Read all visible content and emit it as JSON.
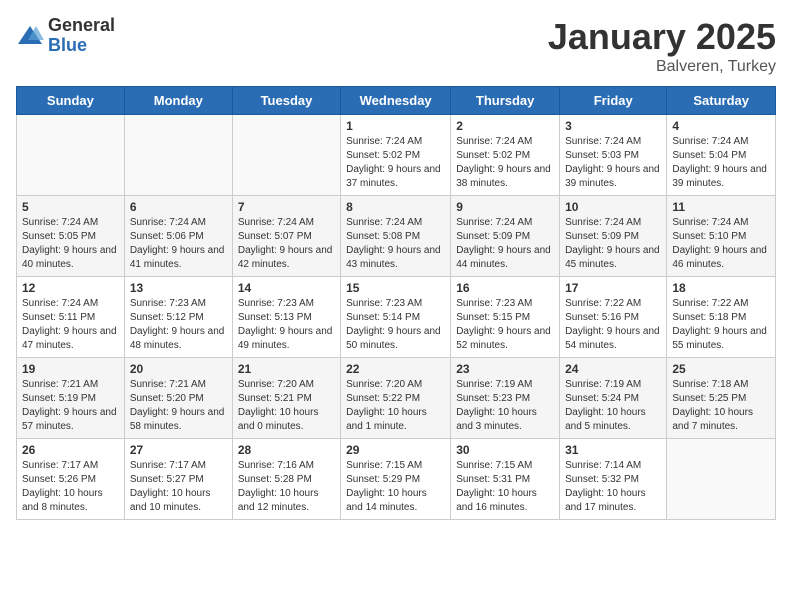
{
  "logo": {
    "general": "General",
    "blue": "Blue"
  },
  "title": {
    "month": "January 2025",
    "location": "Balveren, Turkey"
  },
  "weekdays": [
    "Sunday",
    "Monday",
    "Tuesday",
    "Wednesday",
    "Thursday",
    "Friday",
    "Saturday"
  ],
  "weeks": [
    [
      {
        "day": "",
        "info": ""
      },
      {
        "day": "",
        "info": ""
      },
      {
        "day": "",
        "info": ""
      },
      {
        "day": "1",
        "info": "Sunrise: 7:24 AM\nSunset: 5:02 PM\nDaylight: 9 hours and 37 minutes."
      },
      {
        "day": "2",
        "info": "Sunrise: 7:24 AM\nSunset: 5:02 PM\nDaylight: 9 hours and 38 minutes."
      },
      {
        "day": "3",
        "info": "Sunrise: 7:24 AM\nSunset: 5:03 PM\nDaylight: 9 hours and 39 minutes."
      },
      {
        "day": "4",
        "info": "Sunrise: 7:24 AM\nSunset: 5:04 PM\nDaylight: 9 hours and 39 minutes."
      }
    ],
    [
      {
        "day": "5",
        "info": "Sunrise: 7:24 AM\nSunset: 5:05 PM\nDaylight: 9 hours and 40 minutes."
      },
      {
        "day": "6",
        "info": "Sunrise: 7:24 AM\nSunset: 5:06 PM\nDaylight: 9 hours and 41 minutes."
      },
      {
        "day": "7",
        "info": "Sunrise: 7:24 AM\nSunset: 5:07 PM\nDaylight: 9 hours and 42 minutes."
      },
      {
        "day": "8",
        "info": "Sunrise: 7:24 AM\nSunset: 5:08 PM\nDaylight: 9 hours and 43 minutes."
      },
      {
        "day": "9",
        "info": "Sunrise: 7:24 AM\nSunset: 5:09 PM\nDaylight: 9 hours and 44 minutes."
      },
      {
        "day": "10",
        "info": "Sunrise: 7:24 AM\nSunset: 5:09 PM\nDaylight: 9 hours and 45 minutes."
      },
      {
        "day": "11",
        "info": "Sunrise: 7:24 AM\nSunset: 5:10 PM\nDaylight: 9 hours and 46 minutes."
      }
    ],
    [
      {
        "day": "12",
        "info": "Sunrise: 7:24 AM\nSunset: 5:11 PM\nDaylight: 9 hours and 47 minutes."
      },
      {
        "day": "13",
        "info": "Sunrise: 7:23 AM\nSunset: 5:12 PM\nDaylight: 9 hours and 48 minutes."
      },
      {
        "day": "14",
        "info": "Sunrise: 7:23 AM\nSunset: 5:13 PM\nDaylight: 9 hours and 49 minutes."
      },
      {
        "day": "15",
        "info": "Sunrise: 7:23 AM\nSunset: 5:14 PM\nDaylight: 9 hours and 50 minutes."
      },
      {
        "day": "16",
        "info": "Sunrise: 7:23 AM\nSunset: 5:15 PM\nDaylight: 9 hours and 52 minutes."
      },
      {
        "day": "17",
        "info": "Sunrise: 7:22 AM\nSunset: 5:16 PM\nDaylight: 9 hours and 54 minutes."
      },
      {
        "day": "18",
        "info": "Sunrise: 7:22 AM\nSunset: 5:18 PM\nDaylight: 9 hours and 55 minutes."
      }
    ],
    [
      {
        "day": "19",
        "info": "Sunrise: 7:21 AM\nSunset: 5:19 PM\nDaylight: 9 hours and 57 minutes."
      },
      {
        "day": "20",
        "info": "Sunrise: 7:21 AM\nSunset: 5:20 PM\nDaylight: 9 hours and 58 minutes."
      },
      {
        "day": "21",
        "info": "Sunrise: 7:20 AM\nSunset: 5:21 PM\nDaylight: 10 hours and 0 minutes."
      },
      {
        "day": "22",
        "info": "Sunrise: 7:20 AM\nSunset: 5:22 PM\nDaylight: 10 hours and 1 minute."
      },
      {
        "day": "23",
        "info": "Sunrise: 7:19 AM\nSunset: 5:23 PM\nDaylight: 10 hours and 3 minutes."
      },
      {
        "day": "24",
        "info": "Sunrise: 7:19 AM\nSunset: 5:24 PM\nDaylight: 10 hours and 5 minutes."
      },
      {
        "day": "25",
        "info": "Sunrise: 7:18 AM\nSunset: 5:25 PM\nDaylight: 10 hours and 7 minutes."
      }
    ],
    [
      {
        "day": "26",
        "info": "Sunrise: 7:17 AM\nSunset: 5:26 PM\nDaylight: 10 hours and 8 minutes."
      },
      {
        "day": "27",
        "info": "Sunrise: 7:17 AM\nSunset: 5:27 PM\nDaylight: 10 hours and 10 minutes."
      },
      {
        "day": "28",
        "info": "Sunrise: 7:16 AM\nSunset: 5:28 PM\nDaylight: 10 hours and 12 minutes."
      },
      {
        "day": "29",
        "info": "Sunrise: 7:15 AM\nSunset: 5:29 PM\nDaylight: 10 hours and 14 minutes."
      },
      {
        "day": "30",
        "info": "Sunrise: 7:15 AM\nSunset: 5:31 PM\nDaylight: 10 hours and 16 minutes."
      },
      {
        "day": "31",
        "info": "Sunrise: 7:14 AM\nSunset: 5:32 PM\nDaylight: 10 hours and 17 minutes."
      },
      {
        "day": "",
        "info": ""
      }
    ]
  ]
}
